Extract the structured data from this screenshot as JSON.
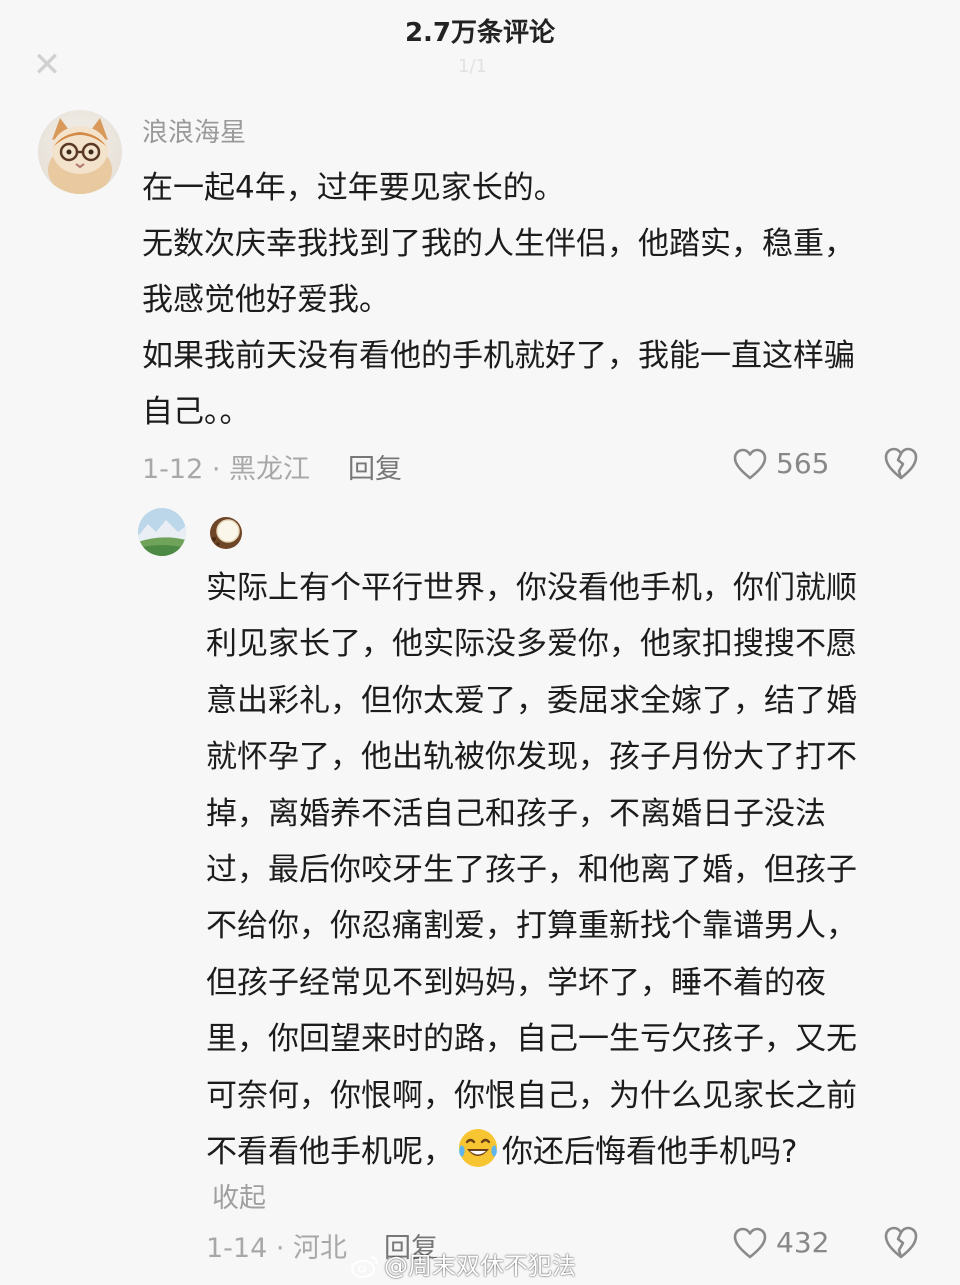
{
  "header": {
    "title": "2.7万条评论",
    "faint_text": "1/1"
  },
  "main_comment": {
    "author": "浪浪海星",
    "avatar": "cat-with-glasses-avatar",
    "lines": [
      "在一起4年，过年要见家长的。",
      "无数次庆幸我找到了我的人生伴侣，他踏实，稳重，",
      "我感觉他好爱我。",
      "如果我前天没有看他的手机就好了，我能一直这样骗",
      "自己。。"
    ],
    "meta": "1-12 · 黑龙江",
    "reply_label": "回复",
    "like_count": "565"
  },
  "reply_comment": {
    "avatar": "landscape-avatar",
    "author_icon": "coconut-icon",
    "lines": [
      "实际上有个平行世界，你没看他手机，你们就顺",
      "利见家长了，他实际没多爱你，他家扣搜搜不愿",
      "意出彩礼，但你太爱了，委屈求全嫁了，结了婚",
      "就怀孕了，他出轨被你发现，孩子月份大了打不",
      "掉，离婚养不活自己和孩子，不离婚日子没法",
      "过，最后你咬牙生了孩子，和他离了婚，但孩子",
      "不给你，你忍痛割爱，打算重新找个靠谱男人，",
      "但孩子经常见不到妈妈，学坏了，睡不着的夜",
      "里，你回望来时的路，自己一生亏欠孩子，又无",
      "可奈何，你恨啊，你恨自己，为什么见家长之前"
    ],
    "last_line_before_emoji": "不看看他手机呢，",
    "last_line_after_emoji": "你还后悔看他手机吗?",
    "emoji": "laughing-tears-emoji",
    "collapse_label": "收起",
    "meta": "1-14 · 河北",
    "reply_label": "回复",
    "like_count": "432"
  },
  "watermark": {
    "text": "@周末双休不犯法",
    "logo": "weibo-logo"
  },
  "colors": {
    "background": "#f7f7f7",
    "text": "#1c1c1c",
    "meta": "#a8a8a8"
  }
}
